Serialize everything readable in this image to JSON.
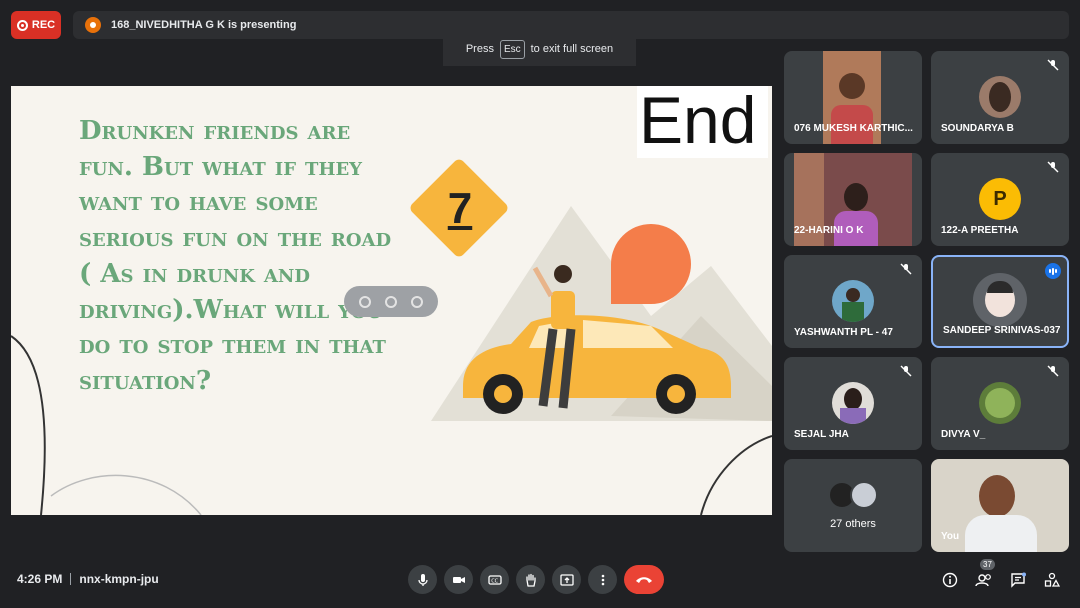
{
  "recording": {
    "label": "REC"
  },
  "presenter": {
    "text": "168_NIVEDHITHA G K is presenting"
  },
  "fullscreen_hint": {
    "press": "Press",
    "key": "Esc",
    "action": "to exit full screen"
  },
  "slide": {
    "body_text": "Drunken friends are fun. But what if they want to have some serious fun on the road ( As in drunk and driving).What will you do to stop them in that situation?",
    "corner_label": "End",
    "sign_number": "7",
    "colors": {
      "text": "#6aa77a",
      "sign": "#f7b53d",
      "car": "#f7b53d",
      "sun": "#f47d4a"
    }
  },
  "participants": [
    {
      "name": "076 MUKESH KARTHIC...",
      "type": "video",
      "muted": false
    },
    {
      "name": "SOUNDARYA B",
      "type": "photo",
      "muted": true
    },
    {
      "name": "22-HARINI O K",
      "type": "video",
      "muted": false
    },
    {
      "name": "122-A PREETHA",
      "type": "letter",
      "letter": "P",
      "muted": true
    },
    {
      "name": "YASHWANTH PL - 47",
      "type": "photo",
      "muted": true
    },
    {
      "name": "SANDEEP SRINIVAS-037",
      "type": "photo",
      "muted": false,
      "speaking": true
    },
    {
      "name": "SEJAL JHA",
      "type": "photo",
      "muted": true
    },
    {
      "name": "DIVYA V_",
      "type": "photo",
      "muted": true
    },
    {
      "name": "27 others",
      "type": "group"
    },
    {
      "name": "You",
      "type": "video"
    }
  ],
  "bottom_bar": {
    "time": "4:26 PM",
    "meeting_code": "nnx-kmpn-jpu",
    "participant_count": "37",
    "controls": [
      "microphone-icon",
      "camera-icon",
      "captions-icon",
      "raise-hand-icon",
      "present-icon",
      "more-options-icon",
      "end-call-icon"
    ],
    "right_icons": [
      "info-icon",
      "people-icon",
      "chat-icon",
      "activities-icon"
    ]
  }
}
